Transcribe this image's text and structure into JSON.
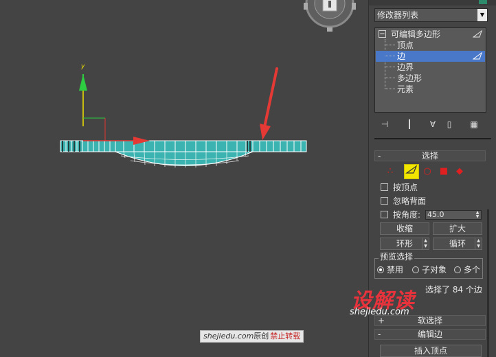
{
  "viewport": {
    "axis_y_label": "y",
    "watermark_site": "shejiedu.com",
    "watermark_yuan": "原创",
    "watermark_forbid": "禁止转载"
  },
  "panel": {
    "modifier_list_label": "修改器列表",
    "stack": {
      "root": "可编辑多边形",
      "items": [
        "顶点",
        "边",
        "边界",
        "多边形",
        "元素"
      ],
      "selected_index": 1
    },
    "selection": {
      "title": "选择",
      "by_vertex": "按顶点",
      "ignore_backfacing": "忽略背面",
      "by_angle": "按角度:",
      "angle_value": "45.0",
      "shrink": "收缩",
      "grow": "扩大",
      "ring": "环形",
      "loop": "循环",
      "preview_title": "预览选择",
      "preview_options": [
        "禁用",
        "子对象",
        "多个"
      ],
      "preview_selected": "禁用",
      "status": "选择了 84 个边"
    },
    "soft_selection": {
      "title": "软选择",
      "sign": "+"
    },
    "edit_edges": {
      "title": "编辑边",
      "sign": "-",
      "insert_vertex": "插入顶点"
    },
    "selection_sign": "-",
    "watermark_logo": "设解读",
    "watermark_url": "shejiedu.com"
  },
  "colors": {
    "selected_row": "#4a78c8",
    "active_subobject": "#f2e500",
    "mesh": "#3bb3b0",
    "arrow": "#e53935",
    "axis_y": "#2ecc40"
  }
}
